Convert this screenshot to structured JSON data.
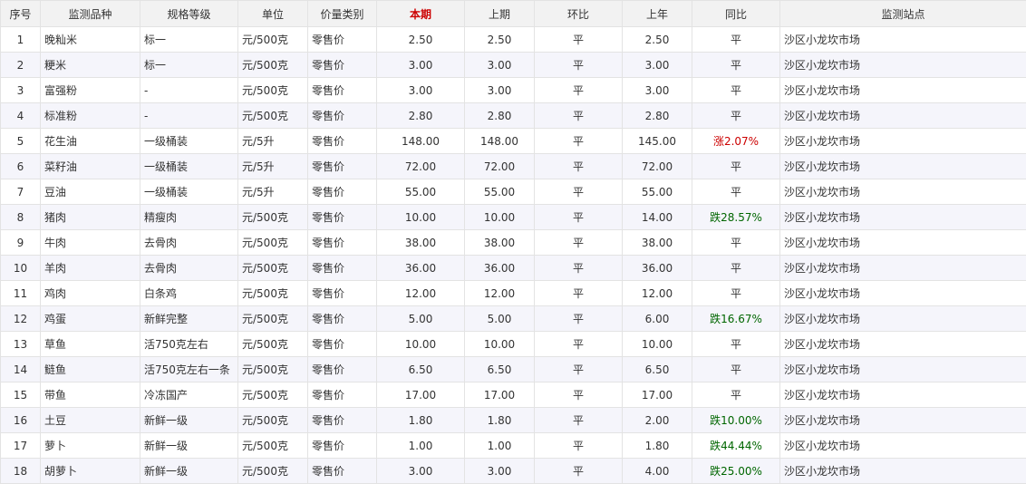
{
  "headers": [
    "序号",
    "监测品种",
    "规格等级",
    "单位",
    "价量类别",
    "本期",
    "上期",
    "环比",
    "上年",
    "同比",
    "监测站点"
  ],
  "rows": [
    [
      "1",
      "晚籼米",
      "标一",
      "元/500克",
      "零售价",
      "2.50",
      "2.50",
      "平",
      "2.50",
      "平",
      "沙区小龙坎市场"
    ],
    [
      "2",
      "粳米",
      "标一",
      "元/500克",
      "零售价",
      "3.00",
      "3.00",
      "平",
      "3.00",
      "平",
      "沙区小龙坎市场"
    ],
    [
      "3",
      "富强粉",
      "-",
      "元/500克",
      "零售价",
      "3.00",
      "3.00",
      "平",
      "3.00",
      "平",
      "沙区小龙坎市场"
    ],
    [
      "4",
      "标准粉",
      "-",
      "元/500克",
      "零售价",
      "2.80",
      "2.80",
      "平",
      "2.80",
      "平",
      "沙区小龙坎市场"
    ],
    [
      "5",
      "花生油",
      "一级桶装",
      "元/5升",
      "零售价",
      "148.00",
      "148.00",
      "平",
      "145.00",
      "涨2.07%",
      "沙区小龙坎市场"
    ],
    [
      "6",
      "菜籽油",
      "一级桶装",
      "元/5升",
      "零售价",
      "72.00",
      "72.00",
      "平",
      "72.00",
      "平",
      "沙区小龙坎市场"
    ],
    [
      "7",
      "豆油",
      "一级桶装",
      "元/5升",
      "零售价",
      "55.00",
      "55.00",
      "平",
      "55.00",
      "平",
      "沙区小龙坎市场"
    ],
    [
      "8",
      "猪肉",
      "精瘦肉",
      "元/500克",
      "零售价",
      "10.00",
      "10.00",
      "平",
      "14.00",
      "跌28.57%",
      "沙区小龙坎市场"
    ],
    [
      "9",
      "牛肉",
      "去骨肉",
      "元/500克",
      "零售价",
      "38.00",
      "38.00",
      "平",
      "38.00",
      "平",
      "沙区小龙坎市场"
    ],
    [
      "10",
      "羊肉",
      "去骨肉",
      "元/500克",
      "零售价",
      "36.00",
      "36.00",
      "平",
      "36.00",
      "平",
      "沙区小龙坎市场"
    ],
    [
      "11",
      "鸡肉",
      "白条鸡",
      "元/500克",
      "零售价",
      "12.00",
      "12.00",
      "平",
      "12.00",
      "平",
      "沙区小龙坎市场"
    ],
    [
      "12",
      "鸡蛋",
      "新鲜完整",
      "元/500克",
      "零售价",
      "5.00",
      "5.00",
      "平",
      "6.00",
      "跌16.67%",
      "沙区小龙坎市场"
    ],
    [
      "13",
      "草鱼",
      "活750克左右",
      "元/500克",
      "零售价",
      "10.00",
      "10.00",
      "平",
      "10.00",
      "平",
      "沙区小龙坎市场"
    ],
    [
      "14",
      "鲢鱼",
      "活750克左右一条",
      "元/500克",
      "零售价",
      "6.50",
      "6.50",
      "平",
      "6.50",
      "平",
      "沙区小龙坎市场"
    ],
    [
      "15",
      "带鱼",
      "冷冻国产",
      "元/500克",
      "零售价",
      "17.00",
      "17.00",
      "平",
      "17.00",
      "平",
      "沙区小龙坎市场"
    ],
    [
      "16",
      "土豆",
      "新鲜一级",
      "元/500克",
      "零售价",
      "1.80",
      "1.80",
      "平",
      "2.00",
      "跌10.00%",
      "沙区小龙坎市场"
    ],
    [
      "17",
      "萝卜",
      "新鲜一级",
      "元/500克",
      "零售价",
      "1.00",
      "1.00",
      "平",
      "1.80",
      "跌44.44%",
      "沙区小龙坎市场"
    ],
    [
      "18",
      "胡萝卜",
      "新鲜一级",
      "元/500克",
      "零售价",
      "3.00",
      "3.00",
      "平",
      "4.00",
      "跌25.00%",
      "沙区小龙坎市场"
    ]
  ],
  "colors": {
    "rise": "#cc0000",
    "fall": "#006600",
    "header_highlight": "#cc0000"
  }
}
